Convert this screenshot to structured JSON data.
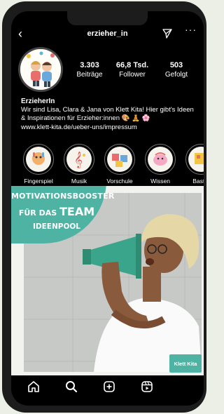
{
  "profile": {
    "username": "erzieher_in",
    "stats": [
      {
        "value": "3.303",
        "label": "Beiträge"
      },
      {
        "value": "66,8 Tsd.",
        "label": "Follower"
      },
      {
        "value": "503",
        "label": "Gefolgt"
      }
    ],
    "name": "ErzieherIn",
    "bio": "Wir sind Lisa, Clara & Jana von Klett Kita! Hier gibt's Ideen & Inspirationen für Erzieher:innen 🎨 🧘 🌸",
    "link": "www.klett-kita.de/ueber-uns/impressum"
  },
  "highlights": [
    {
      "label": "Fingerspiel"
    },
    {
      "label": "Musik"
    },
    {
      "label": "Vorschule"
    },
    {
      "label": "Wissen"
    },
    {
      "label": "Bastel"
    }
  ],
  "post": {
    "headline_line1": "MOTIVATIONSBOOSTER",
    "headline_line2_prefix": "FÜR DAS",
    "headline_line2_big": "TEAM",
    "headline_line3": "IDEENPOOL",
    "logo_text": "Klett Kita"
  },
  "colors": {
    "accent": "#4fb3a4",
    "background": "#000000"
  },
  "icons": {
    "back": "arrow-left-icon",
    "send": "paper-plane-icon",
    "more": "more-dots-icon",
    "nav": [
      "home-icon",
      "search-icon",
      "add-post-icon",
      "reels-icon"
    ]
  }
}
